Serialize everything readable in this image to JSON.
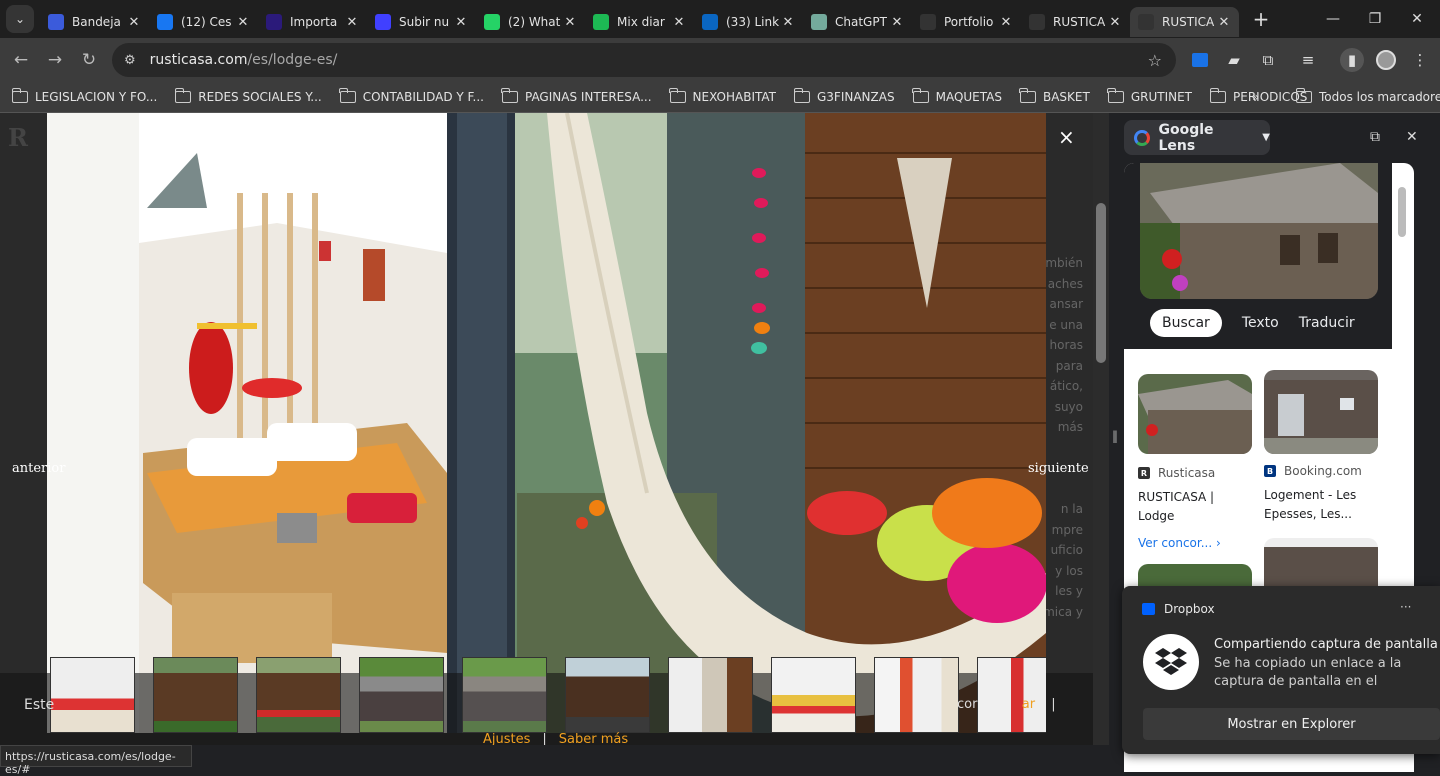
{
  "tabs": [
    {
      "label": "Bandeja",
      "icon": "v-icon",
      "color": "#3b5bdb"
    },
    {
      "label": "(12) Ces",
      "icon": "facebook-icon",
      "color": "#1877f2"
    },
    {
      "label": "Importa",
      "icon": "pro-icon",
      "color": "#2b1a7a"
    },
    {
      "label": "Subir nu",
      "icon": "upload-icon",
      "color": "#4040ff"
    },
    {
      "label": "(2) What",
      "icon": "whatsapp-icon",
      "color": "#25d366"
    },
    {
      "label": "Mix diar",
      "icon": "spotify-icon",
      "color": "#1db954"
    },
    {
      "label": "(33) Link",
      "icon": "linkedin-icon",
      "color": "#0a66c2"
    },
    {
      "label": "ChatGPT",
      "icon": "chatgpt-icon",
      "color": "#74aa9c"
    },
    {
      "label": "Portfolio",
      "icon": "rc-icon",
      "color": "#333333"
    },
    {
      "label": "RUSTICA",
      "icon": "rc-icon",
      "color": "#333333"
    },
    {
      "label": "RUSTICA",
      "icon": "rc-icon",
      "color": "#333333",
      "active": true
    }
  ],
  "address": {
    "host": "rusticasa.com",
    "path": "/es/lodge-es/"
  },
  "bookmarks": [
    "LEGISLACION Y FO...",
    "REDES SOCIALES Y...",
    "CONTABILIDAD Y F...",
    "PAGINAS INTERESA...",
    "NEXOHABITAT",
    "G3FINANZAS",
    "MAQUETAS",
    "BASKET",
    "GRUTINET",
    "PERIODICOS"
  ],
  "bookmarks_all": "Todos los marcadores",
  "page": {
    "right_text": [
      "mbién",
      "aches",
      "ansar",
      "e una",
      "horas",
      "para",
      "ático,",
      "suyo",
      "más",
      "",
      "",
      "",
      "n la",
      "mpre",
      "uficio",
      "y los",
      "les y",
      "mica y"
    ],
    "lightbox": {
      "prev": "anterior",
      "next": "siguiente",
      "close": "×"
    },
    "cookie": {
      "left": "Este",
      "right_prefix": "cor",
      "right_link": "ar",
      "sep": "|",
      "link1": "Ajustes",
      "link2": "Saber más"
    }
  },
  "status_url": "https://rusticasa.com/es/lodge-es/#",
  "lens": {
    "title": "Google Lens",
    "tabs": [
      "Buscar",
      "Texto",
      "Traducir"
    ],
    "results": [
      {
        "source": "Rusticasa",
        "title": "RUSTICASA | Lodge",
        "more": "Ver concor..."
      },
      {
        "source": "Booking.com",
        "title": "Logement - Les Epesses, Les..."
      }
    ]
  },
  "dropbox": {
    "app": "Dropbox",
    "title": "Compartiendo captura de pantalla",
    "body": "Se ha copiado un enlace a la captura de pantalla en el portapapeles.",
    "button": "Mostrar en Explorer",
    "menu": "···"
  }
}
